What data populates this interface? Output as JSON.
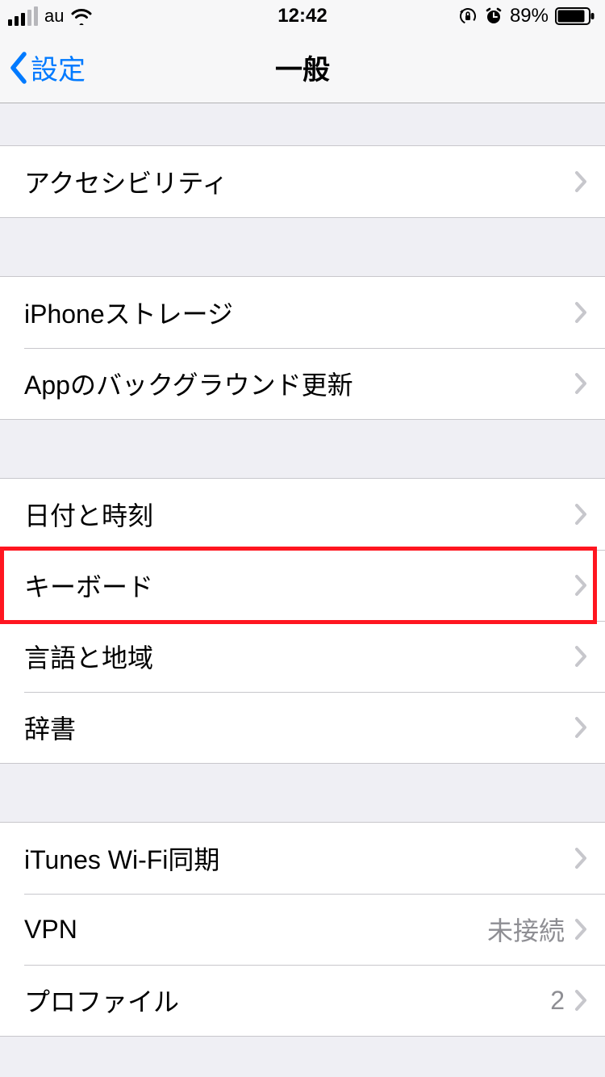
{
  "statusbar": {
    "carrier": "au",
    "time": "12:42",
    "battery_pct": "89%"
  },
  "nav": {
    "back_label": "設定",
    "title": "一般"
  },
  "groups": {
    "g1": {
      "accessibility": "アクセシビリティ"
    },
    "g2": {
      "iphone_storage": "iPhoneストレージ",
      "background_refresh": "Appのバックグラウンド更新"
    },
    "g3": {
      "date_time": "日付と時刻",
      "keyboard": "キーボード",
      "language_region": "言語と地域",
      "dictionary": "辞書"
    },
    "g4": {
      "itunes_wifi_sync": "iTunes Wi-Fi同期",
      "vpn": "VPN",
      "vpn_status": "未接続",
      "profile": "プロファイル",
      "profile_count": "2"
    }
  },
  "highlight": {
    "target": "keyboard"
  }
}
